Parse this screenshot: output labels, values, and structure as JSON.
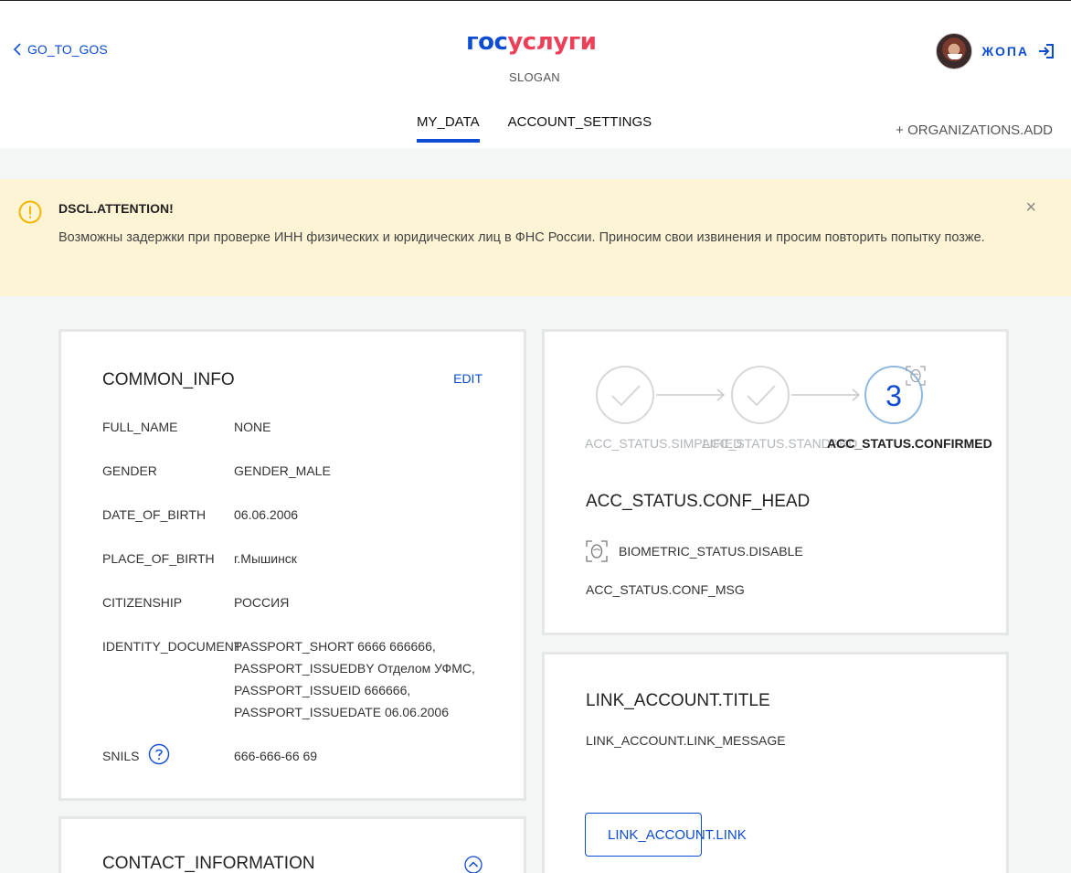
{
  "header": {
    "back_label": "GO_TO_GOS",
    "logo_part1": "гос",
    "logo_part2": "услуги",
    "slogan": "SLOGAN",
    "user_name": "ЖОПА",
    "tabs": [
      {
        "label": "MY_DATA",
        "active": true
      },
      {
        "label": "ACCOUNT_SETTINGS",
        "active": false
      }
    ],
    "org_add": "+ ORGANIZATIONS.ADD"
  },
  "banner": {
    "title": "DSCL.ATTENTION!",
    "text": "Возможны задержки при проверке ИНН физических и юридических лиц в ФНС России. Приносим свои извинения и просим повторить попытку позже.",
    "close": "×"
  },
  "common_info": {
    "title": "COMMON_INFO",
    "edit": "EDIT",
    "rows": [
      {
        "label": "FULL_NAME",
        "value": "NONE"
      },
      {
        "label": "GENDER",
        "value": "GENDER_MALE"
      },
      {
        "label": "DATE_OF_BIRTH",
        "value": "06.06.2006"
      },
      {
        "label": "PLACE_OF_BIRTH",
        "value": "г.Мышинск"
      },
      {
        "label": "CITIZENSHIP",
        "value": "РОССИЯ"
      },
      {
        "label": "IDENTITY_DOCUMENT",
        "value_lines": [
          "PASSPORT_SHORT 6666 666666,",
          "PASSPORT_ISSUEDBY Отделом УФМС,",
          "PASSPORT_ISSUEID 666666,",
          "PASSPORT_ISSUEDATE 06.06.2006"
        ]
      },
      {
        "label": "SNILS",
        "value": "666-666-66 69"
      }
    ]
  },
  "account_status": {
    "steps": [
      {
        "label": "ACC_STATUS.SIMPLIFIED",
        "done": true
      },
      {
        "label": "ACC_STATUS.STANDARD",
        "done": true
      },
      {
        "label": "ACC_STATUS.CONFIRMED",
        "number": "3",
        "current": true
      }
    ],
    "head": "ACC_STATUS.CONF_HEAD",
    "biometric": "BIOMETRIC_STATUS.DISABLE",
    "message": "ACC_STATUS.CONF_MSG"
  },
  "link_account": {
    "title": "LINK_ACCOUNT.TITLE",
    "message": "LINK_ACCOUNT.LINK_MESSAGE",
    "button": "LINK_ACCOUNT.LINK"
  },
  "contact": {
    "title": "CONTACT_INFORMATION"
  },
  "colors": {
    "primary": "#0d4cd3",
    "brand_red": "#ee3f58",
    "banner_bg": "#fdf4d5",
    "warning": "#f2b600"
  }
}
